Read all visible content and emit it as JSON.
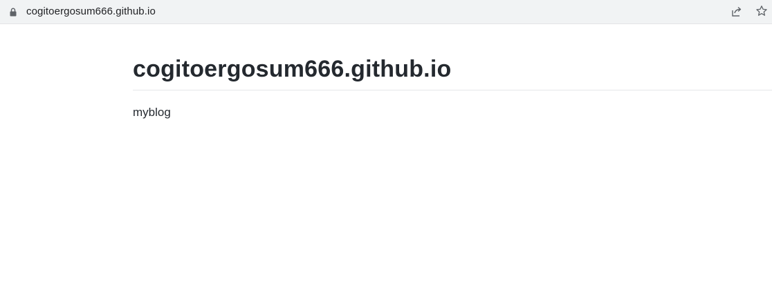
{
  "browser": {
    "url": "cogitoergosum666.github.io",
    "lock_icon": "lock-icon",
    "share_icon": "share-icon",
    "bookmark_icon": "star-icon"
  },
  "page": {
    "title": "cogitoergosum666.github.io",
    "description": "myblog"
  },
  "colors": {
    "address_bar_bg": "#f1f3f4",
    "text": "#24292f",
    "divider": "#e5e7ea"
  }
}
